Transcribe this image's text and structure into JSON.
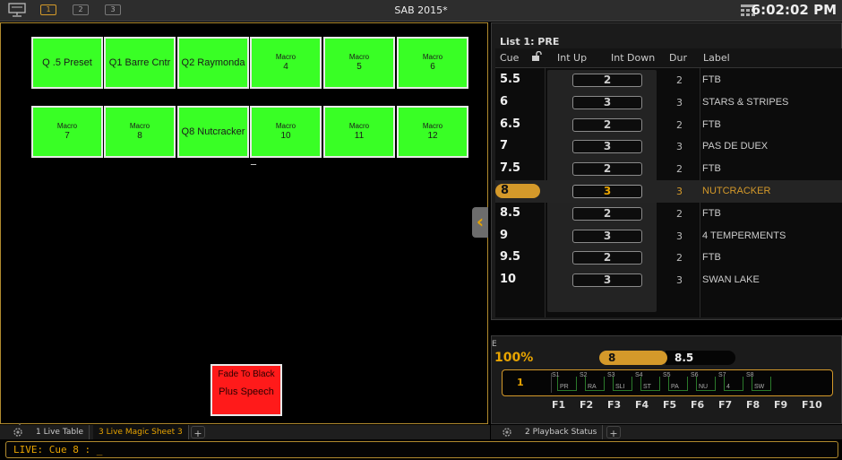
{
  "topbar": {
    "show_title": "SAB 2015*",
    "clock": "6:02:02 PM",
    "workspaces": [
      "1",
      "2",
      "3"
    ]
  },
  "magic_sheet": {
    "row1": [
      {
        "type": "big",
        "text": "Q .5 Preset"
      },
      {
        "type": "big",
        "text": "Q1 Barre Cntr"
      },
      {
        "type": "big",
        "text": "Q2 Raymonda"
      },
      {
        "type": "macro",
        "label": "Macro",
        "num": "4"
      },
      {
        "type": "macro",
        "label": "Macro",
        "num": "5"
      },
      {
        "type": "macro",
        "label": "Macro",
        "num": "6"
      }
    ],
    "row2": [
      {
        "type": "macro",
        "label": "Macro",
        "num": "7"
      },
      {
        "type": "macro",
        "label": "Macro",
        "num": "8"
      },
      {
        "type": "big",
        "text": "Q8 Nutcracker"
      },
      {
        "type": "macro",
        "label": "Macro",
        "num": "10"
      },
      {
        "type": "macro",
        "label": "Macro",
        "num": "11"
      },
      {
        "type": "macro",
        "label": "Macro",
        "num": "12"
      }
    ],
    "tilde": "_",
    "red_button": {
      "line1": "Fade To Black",
      "line2": "Plus Speech"
    },
    "colors": {
      "green": "#39ff25",
      "red": "#ff1a1a",
      "accent": "#d4992a"
    }
  },
  "cue_list": {
    "title": "List 1: PRE",
    "headers": {
      "cue": "Cue",
      "int_up": "Int Up",
      "int_down": "Int Down",
      "dur": "Dur",
      "label": "Label"
    },
    "rows": [
      {
        "cue": "5.5",
        "int": "2",
        "dur": "2",
        "label": "FTB",
        "selected": false
      },
      {
        "cue": "6",
        "int": "3",
        "dur": "3",
        "label": "STARS & STRIPES",
        "selected": false
      },
      {
        "cue": "6.5",
        "int": "2",
        "dur": "2",
        "label": "FTB",
        "selected": false
      },
      {
        "cue": "7",
        "int": "3",
        "dur": "3",
        "label": "PAS DE DUEX",
        "selected": false
      },
      {
        "cue": "7.5",
        "int": "2",
        "dur": "2",
        "label": "FTB",
        "selected": false
      },
      {
        "cue": "8",
        "int": "3",
        "dur": "3",
        "label": "NUTCRACKER",
        "selected": true
      },
      {
        "cue": "8.5",
        "int": "2",
        "dur": "2",
        "label": "FTB",
        "selected": false
      },
      {
        "cue": "9",
        "int": "3",
        "dur": "3",
        "label": "4 TEMPERMENTS",
        "selected": false
      },
      {
        "cue": "9.5",
        "int": "2",
        "dur": "2",
        "label": "FTB",
        "selected": false
      },
      {
        "cue": "10",
        "int": "3",
        "dur": "3",
        "label": "SWAN LAKE",
        "selected": false
      }
    ]
  },
  "playback": {
    "edge_label": "E",
    "percent": "100%",
    "current_cue": "8",
    "next_cue": "8.5",
    "fader_num": "1",
    "slots": [
      {
        "s": "S1",
        "lbl": "PR"
      },
      {
        "s": "S2",
        "lbl": "RA"
      },
      {
        "s": "S3",
        "lbl": "SLI"
      },
      {
        "s": "S4",
        "lbl": "ST"
      },
      {
        "s": "S5",
        "lbl": "PA"
      },
      {
        "s": "S6",
        "lbl": "NU"
      },
      {
        "s": "S7",
        "lbl": "4"
      },
      {
        "s": "S8",
        "lbl": "SW"
      }
    ],
    "fkeys": [
      "F1",
      "F2",
      "F3",
      "F4",
      "F5",
      "F6",
      "F7",
      "F8",
      "F9",
      "F10"
    ]
  },
  "tabs_left": [
    "1 Live Table",
    "3 Live Magic Sheet 3"
  ],
  "tabs_right": [
    "2 Playback Status"
  ],
  "tab_plus": "+",
  "command_line": "LIVE: Cue  8 :  _"
}
